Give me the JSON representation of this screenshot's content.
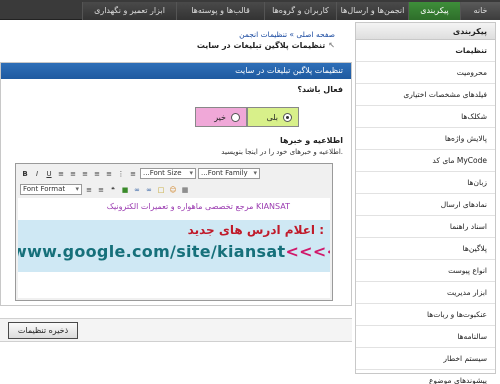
{
  "tabs": [
    "خانه",
    "پیکربندی",
    "انجمن‌ها و ارسال‌ها",
    "کاربران و گروه‌ها",
    "قالب‌ها و پوسته‌ها",
    "ابزار تعمیر و نگهداری"
  ],
  "breadcrumb": "صفحه اصلی » تنظیمات انجمن",
  "page_title": "تنظیمات پلاگین تبلیغات در سایت",
  "panel": {
    "header": "تنظیمات پلاگین تبلیغات در سایت",
    "active_question": "فعال باشد؟",
    "yes_label": "بلی",
    "no_label": "خیر",
    "news_label": "اطلاعیه و خبرها",
    "news_desc": "اطلاعیه و خبرهای خود را در اینجا بنویسید."
  },
  "editor": {
    "font_size_label": "Font Size",
    "font_family_label": "Font Family",
    "font_format_label": "Font Format",
    "slogan": "مرجع تخصصی ماهواره و تعمیرات الکترونیک KIANSAT",
    "banner_line1": "اعلام ادرس های جدید :",
    "banner_url": "www.google.com/site/kiansat",
    "banner_arrows": "<<<<"
  },
  "save_label": "ذخیره تنظیمات",
  "sidebar": {
    "title": "پیکربندی",
    "items": [
      "تنظیمات",
      "محرومیت",
      "فیلدهای مشخصات اختیاری",
      "شکلک‌ها",
      "پالایش واژه‌ها",
      "مای کد MyCode",
      "زبان‌ها",
      "نمادهای ارسال",
      "اسناد راهنما",
      "پلاگین‌ها",
      "انواع پیوست",
      "ابزار مدیریت",
      "عنکبوت‌ها و ربات‌ها",
      "سالنامه‌ها",
      "سیستم اخطار",
      "پیشوندهای موضوع"
    ]
  }
}
